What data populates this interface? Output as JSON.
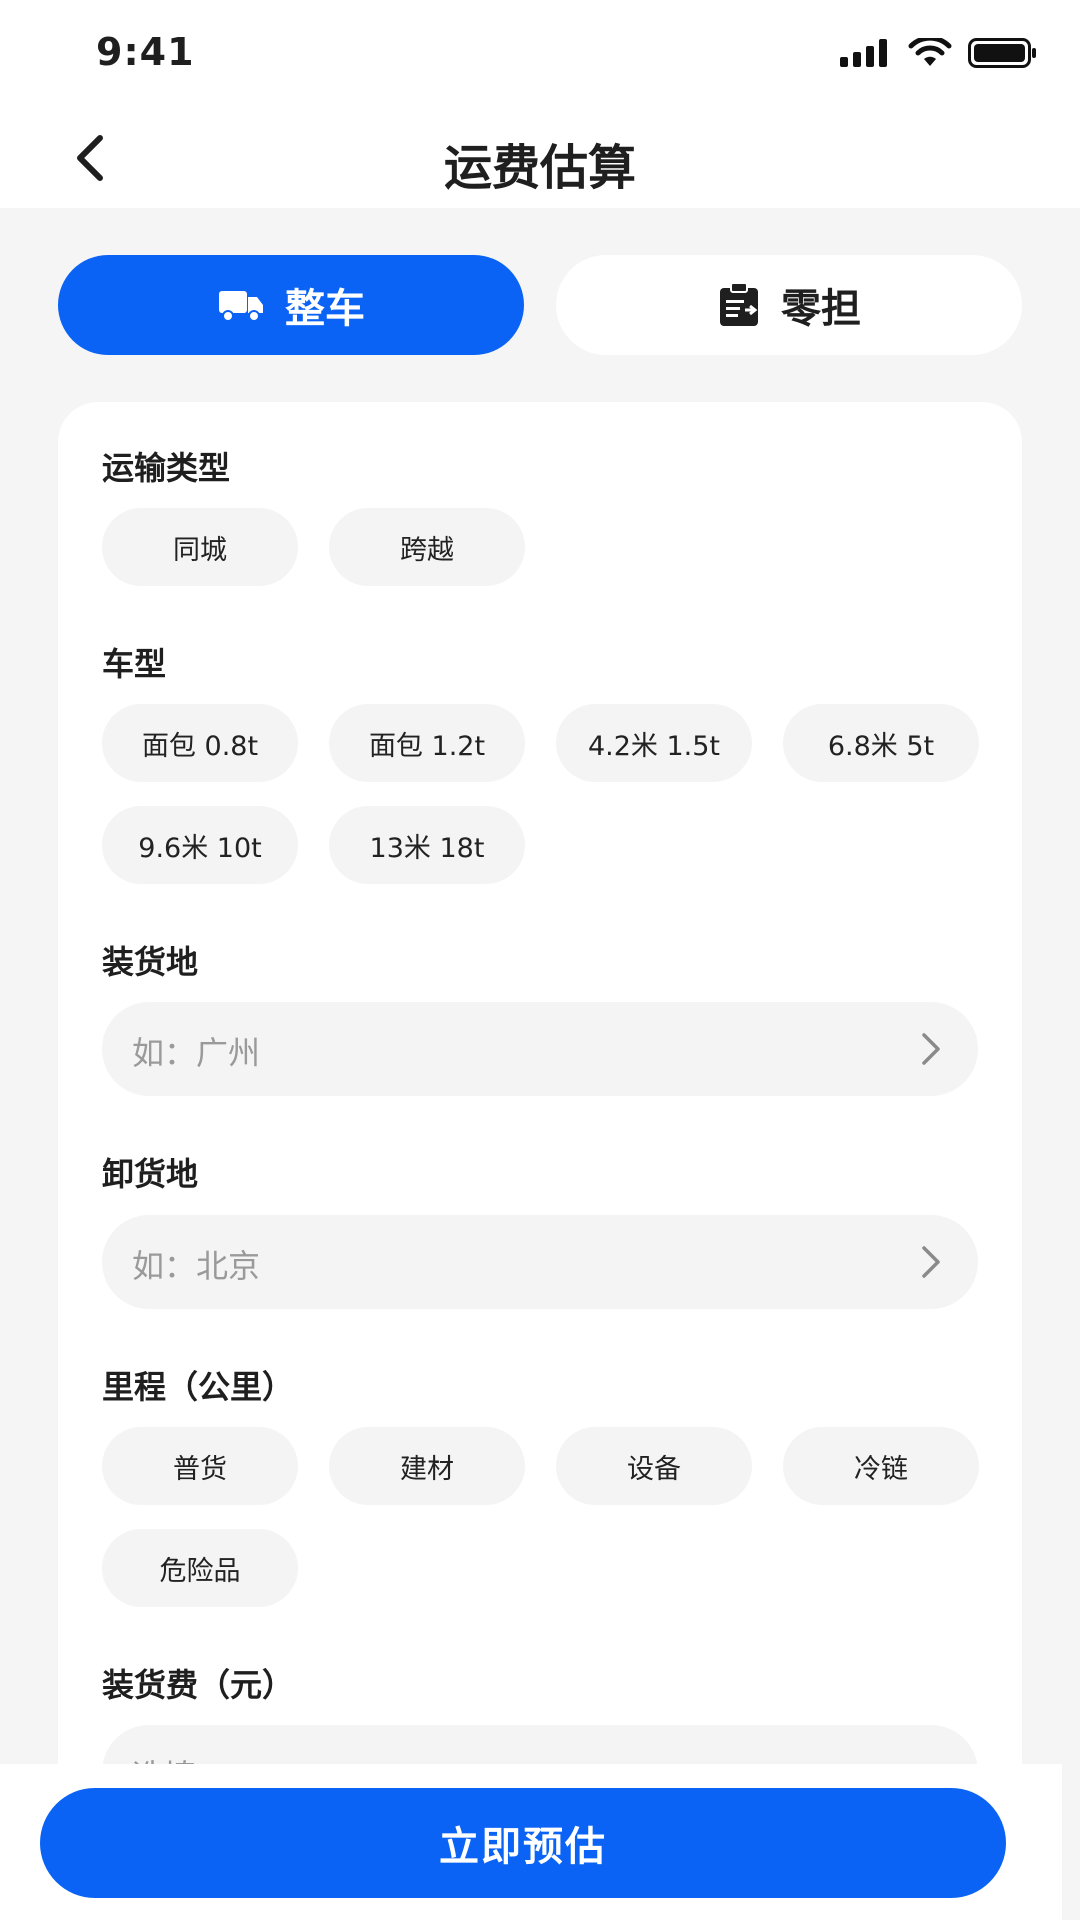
{
  "status_bar": {
    "time": "9:41"
  },
  "nav": {
    "title": "运费估算"
  },
  "tabs": [
    {
      "label": "整车",
      "icon": "truck-icon",
      "active": true
    },
    {
      "label": "零担",
      "icon": "clipboard-icon",
      "active": false
    }
  ],
  "form": {
    "transport_type": {
      "label": "运输类型",
      "options": [
        "同城",
        "跨越"
      ]
    },
    "vehicle_type": {
      "label": "车型",
      "options": [
        "面包 0.8t",
        "面包 1.2t",
        "4.2米 1.5t",
        "6.8米 5t",
        "9.6米 10t",
        "13米 18t"
      ]
    },
    "loading_place": {
      "label": "装货地",
      "placeholder": "如：广州"
    },
    "unloading_place": {
      "label": "卸货地",
      "placeholder": "如：北京"
    },
    "mileage": {
      "label": "里程（公里）",
      "options": [
        "普货",
        "建材",
        "设备",
        "冷链",
        "危险品"
      ]
    },
    "loading_fee": {
      "label": "装货费（元）",
      "placeholder": "选填"
    }
  },
  "cta": {
    "label": "立即预估"
  },
  "colors": {
    "primary": "#0a63f5",
    "background": "#f5f5f5",
    "chip": "#f4f4f4",
    "placeholder": "#9a9a9a"
  }
}
